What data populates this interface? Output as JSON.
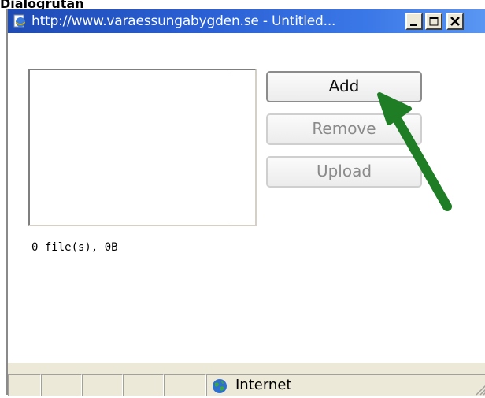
{
  "header": {
    "caption": "Dialogrutan"
  },
  "window": {
    "title": "http://www.varaessungabygden.se - Untitled...",
    "icon": "ie-page-icon",
    "controls": {
      "minimize": "minimize-icon",
      "maximize": "maximize-icon",
      "close": "close-icon"
    }
  },
  "uploader": {
    "buttons": {
      "add": "Add",
      "remove": "Remove",
      "upload": "Upload"
    },
    "file_info": "0 file(s), 0B",
    "file_count": 0
  },
  "annotation": {
    "arrow_color": "#1e7d25"
  },
  "statusbar": {
    "zone_label": "Internet",
    "zone_icon": "globe-icon"
  }
}
